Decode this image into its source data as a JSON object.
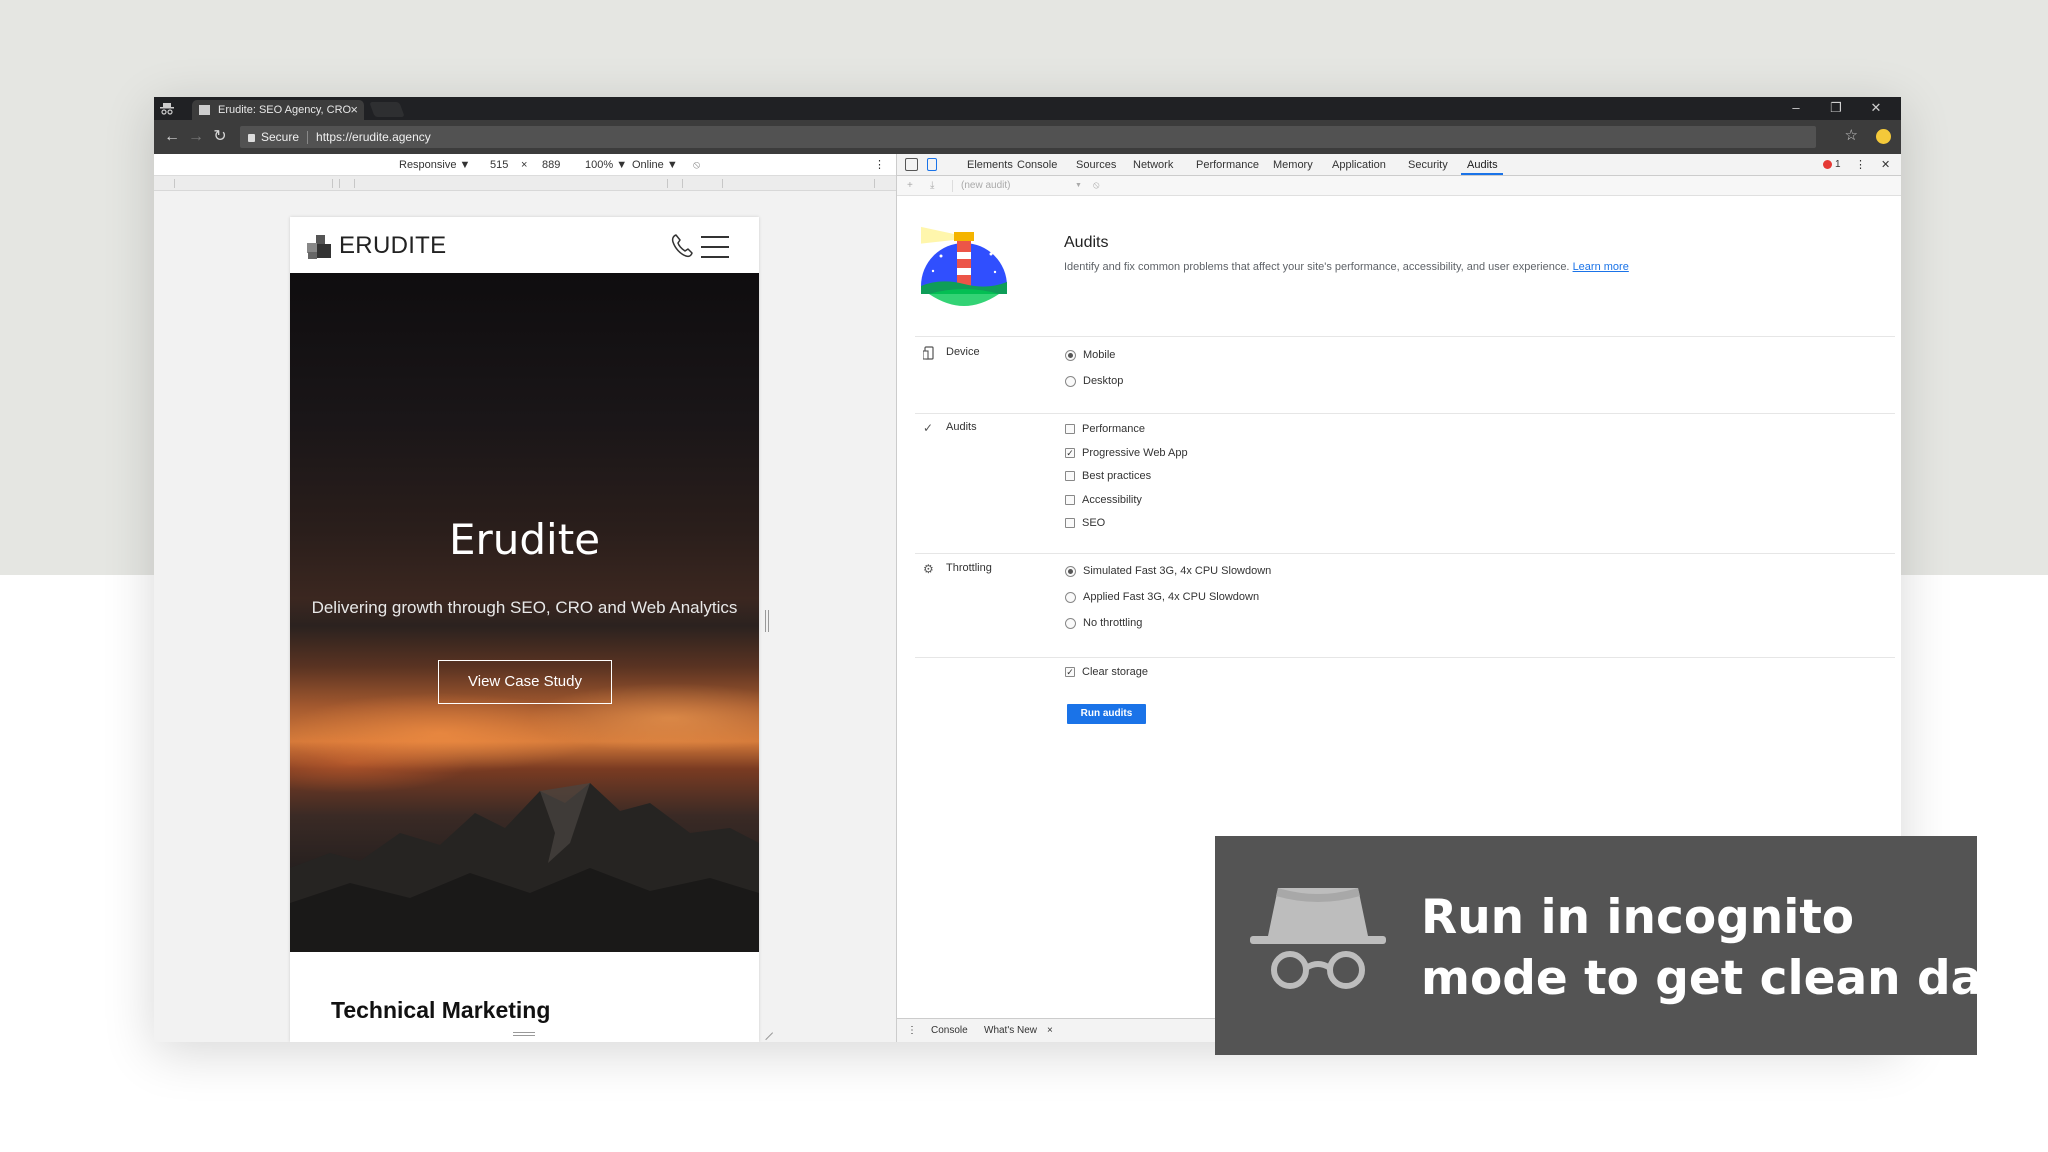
{
  "browser": {
    "tab_title": "Erudite: SEO Agency, CRO",
    "tab_close": "×",
    "window_controls": {
      "minimize": "–",
      "restore": "❐",
      "close": "✕"
    },
    "secure_label": "Secure",
    "url": "https://erudite.agency",
    "nav_icons": [
      "back-arrow-icon",
      "forward-arrow-icon",
      "reload-icon"
    ],
    "star_icon": "☆"
  },
  "device_toolbar": {
    "device": "Responsive ▼",
    "width": "515",
    "times": "×",
    "height": "889",
    "zoom": "100% ▼",
    "network": "Online ▼",
    "rotate_icon": "⦸",
    "more_icon": "⋮"
  },
  "site": {
    "brand": "ERUDITE",
    "hero_title": "Erudite",
    "hero_subtitle": "Delivering growth through SEO, CRO and Web Analytics",
    "hero_button": "View Case Study",
    "section_heading": "Technical Marketing"
  },
  "devtools": {
    "tabs": [
      "Elements",
      "Console",
      "Sources",
      "Network",
      "Performance",
      "Memory",
      "Application",
      "Security",
      "Audits"
    ],
    "active_tab": "Audits",
    "error_count": "1",
    "more_icon": "⋮",
    "close_icon": "✕",
    "sub_add": "+",
    "sub_download": "⤓",
    "audit_select": "(new audit)",
    "audit_select_arrow": "▼",
    "sub_block": "⦸",
    "audits_panel": {
      "title": "Audits",
      "description": "Identify and fix common problems that affect your site's performance, accessibility, and user experience.",
      "learn_more": "Learn more",
      "device_label": "Device",
      "device_options": [
        {
          "label": "Mobile",
          "selected": true
        },
        {
          "label": "Desktop",
          "selected": false
        }
      ],
      "audits_label": "Audits",
      "audits_check": "✓",
      "audit_options": [
        {
          "label": "Performance",
          "checked": false
        },
        {
          "label": "Progressive Web App",
          "checked": true
        },
        {
          "label": "Best practices",
          "checked": false
        },
        {
          "label": "Accessibility",
          "checked": false
        },
        {
          "label": "SEO",
          "checked": false
        }
      ],
      "throttling_label": "Throttling",
      "throttling_icon": "⚙",
      "throttling_options": [
        {
          "label": "Simulated Fast 3G, 4x CPU Slowdown",
          "selected": true
        },
        {
          "label": "Applied Fast 3G, 4x CPU Slowdown",
          "selected": false
        },
        {
          "label": "No throttling",
          "selected": false
        }
      ],
      "clear_storage": "Clear storage",
      "clear_storage_checked": true,
      "run_button": "Run audits"
    },
    "drawer": {
      "more_icon": "⋮",
      "tabs": [
        "Console",
        "What's New"
      ],
      "close": "×"
    }
  },
  "overlay": {
    "line1": "Run in incognito",
    "line2": "mode to get clean data",
    "icon": "incognito-icon"
  },
  "colors": {
    "accent": "#1a73e8",
    "overlay_bg": "#545454",
    "chrome_dark": "#202124"
  }
}
